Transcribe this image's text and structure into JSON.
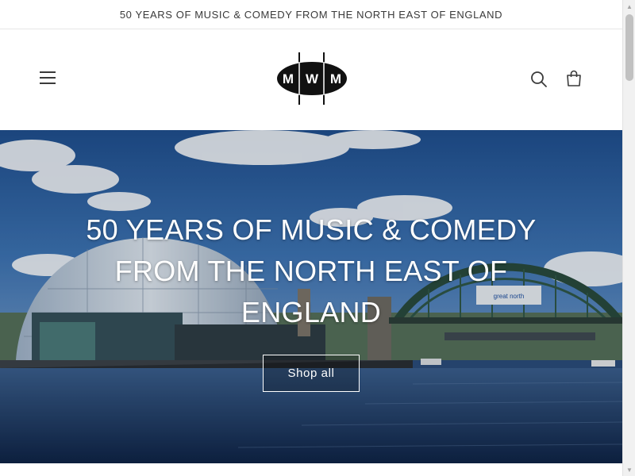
{
  "announcement": {
    "text": "50 YEARS OF MUSIC & COMEDY FROM THE NORTH EAST OF ENGLAND"
  },
  "header": {
    "logo_text": "MWM",
    "icons": {
      "menu": "hamburger-menu-icon",
      "search": "search-icon",
      "cart": "shopping-bag-icon"
    }
  },
  "hero": {
    "title_lines": [
      "50 YEARS OF MUSIC & COMEDY",
      "FROM THE NORTH EAST OF",
      "ENGLAND"
    ],
    "button_label": "Shop all"
  },
  "colors": {
    "text": "#121212",
    "hero_text": "#ffffff",
    "sky": "#2b5797",
    "river": "#1f3a63"
  }
}
